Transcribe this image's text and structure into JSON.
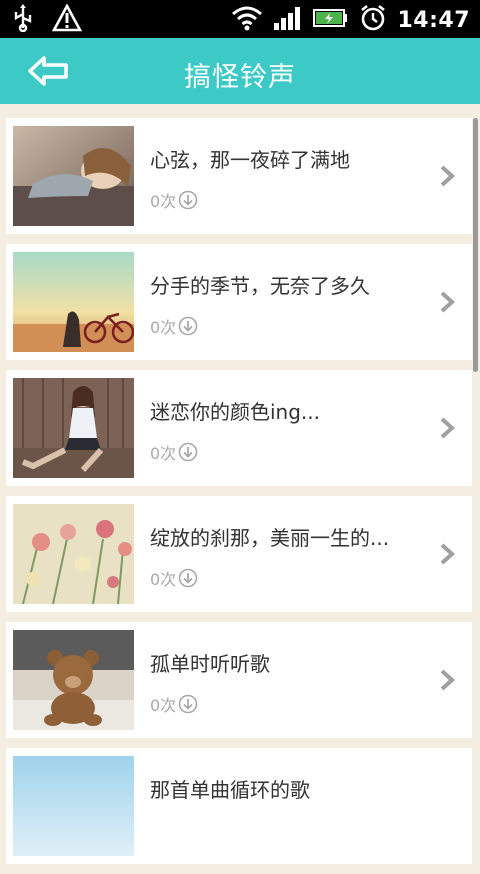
{
  "status_bar": {
    "time": "14:47"
  },
  "header": {
    "title": "搞怪铃声"
  },
  "songs": [
    {
      "title": "心弦，那一夜碎了满地",
      "downloads": "0次"
    },
    {
      "title": "分手的季节，无奈了多久",
      "downloads": "0次"
    },
    {
      "title": "迷恋你的颜色ing...",
      "downloads": "0次"
    },
    {
      "title": "绽放的刹那，美丽一生的...",
      "downloads": "0次"
    },
    {
      "title": "孤单时听听歌",
      "downloads": "0次"
    },
    {
      "title": "那首单曲循环的歌",
      "downloads": ""
    }
  ],
  "colors": {
    "accent": "#3dc9c6",
    "background": "#f3ede2",
    "text": "#333333",
    "meta": "#a9a9a9"
  },
  "icons": [
    "usb-icon",
    "warning-icon",
    "wifi-icon",
    "signal-icon",
    "battery-icon",
    "alarm-icon",
    "back-arrow-icon",
    "download-icon",
    "chevron-right-icon"
  ]
}
